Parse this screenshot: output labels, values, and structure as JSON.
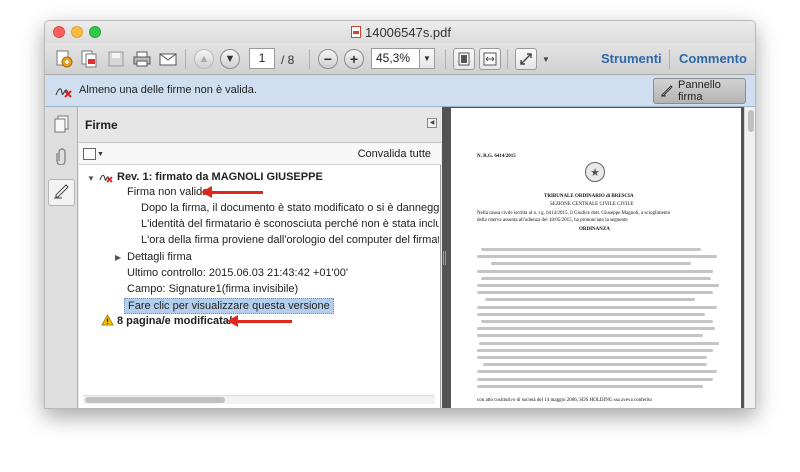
{
  "window": {
    "title": "14006547s.pdf"
  },
  "toolbar": {
    "page_current": "1",
    "page_total": "/ 8",
    "zoom": "45,3%",
    "tools_label": "Strumenti",
    "comment_label": "Commento"
  },
  "signature_bar": {
    "message": "Almeno una delle firme non è valida.",
    "panel_button": "Pannello firma"
  },
  "panel": {
    "title": "Firme",
    "validate_all": "Convalida tutte",
    "tree": {
      "rev_title": "Rev. 1: firmato da MAGNOLI GIUSEPPE",
      "invalid": "Firma non valida:",
      "detail1": "Dopo la firma, il documento è stato modificato o si è danneggiato",
      "detail2": "L'identità del firmatario è sconosciuta perché non è stata inclusa nell'e",
      "detail3": "L'ora della firma proviene dall'orologio del computer del firmatario.",
      "details_node": "Dettagli firma",
      "last_check": "Ultimo controllo: 2015.06.03 21:43:42 +01'00'",
      "field": "Campo: Signature1(firma invisibile)",
      "view_version": "Fare clic per visualizzare questa versione",
      "modified_pages": "8 pagina/e modificata/e"
    }
  },
  "document": {
    "rg": "N. R.G. 6414/2015",
    "court": "TRIBUNALE ORDINARIO di BRESCIA",
    "section": "SEZIONE CENTRALE CIVILE CIVILE",
    "intro1": "Nella causa civile iscritta al n. r.g. 6414/2015, il Giudice dott. Giuseppe Magnoli, a scioglimento",
    "intro2": "della riserva assunta all'udienza del 18/05/2015, ha pronunciato la seguente",
    "heading": "ORDINANZA",
    "bottom_line": "con atto costitutivo di società del 14 maggio 2006",
    "bottom_line_tail": ", SDS HOLDING ssa aveva conferito"
  },
  "icons": {
    "create": "create-pdf-icon",
    "save": "save-icon",
    "print": "print-icon",
    "email": "email-icon",
    "zoom_out": "zoom-out-icon",
    "zoom_in": "zoom-in-icon"
  }
}
